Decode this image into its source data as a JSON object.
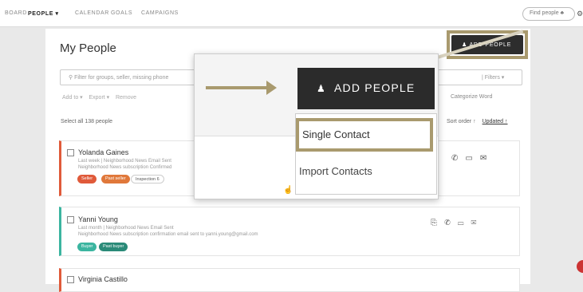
{
  "nav": {
    "items": [
      "BOARD",
      "PEOPLE ▾",
      "CALENDAR",
      "GOALS",
      "CAMPAIGNS"
    ],
    "search_placeholder": "Find people",
    "search_icon_glyph": "♣"
  },
  "page": {
    "title": "My People",
    "add_button_label": "ADD PEOPLE",
    "filter_placeholder": "Filter for groups, seller, missing phone",
    "filters_label": "Filters",
    "actions": [
      "Add to ▾",
      "Export ▾",
      "Remove"
    ],
    "actions_right": "Categorize Word",
    "count_text": "Select all    138 people",
    "sort_label": "Sort order ↑",
    "sort_value": "Updated ↑"
  },
  "contacts": [
    {
      "name": "Yolanda Gaines",
      "line1": "Last week | Neighborhood News Email Sent",
      "line2": "Neighborhood News subscription Confirmed",
      "tags": [
        {
          "label": "Seller",
          "color": "#e05a3a"
        },
        {
          "label": "Past seller",
          "color": "#e0783a"
        },
        {
          "label": "Inspection 6",
          "color": "#ffffff"
        }
      ]
    },
    {
      "name": "Yanni Young",
      "line1": "Last month | Neighborhood News Email Sent",
      "line2": "Neighborhood News subscription confirmation email sent to yanni.young@gmail.com",
      "tags": [
        {
          "label": "Buyer",
          "color": "#3bb5a0"
        },
        {
          "label": "Past buyer",
          "color": "#2a8a78"
        }
      ]
    },
    {
      "name": "Virginia Castillo"
    }
  ],
  "popup": {
    "button_label": "ADD PEOPLE",
    "button_icon": "person-add-icon",
    "option_single": "Single Contact",
    "option_import": "Import Contacts"
  },
  "colors": {
    "highlight": "#a99a6e",
    "dark_button": "#2b2b2b",
    "seller": "#e05a3a",
    "buyer": "#3bb5a0"
  }
}
